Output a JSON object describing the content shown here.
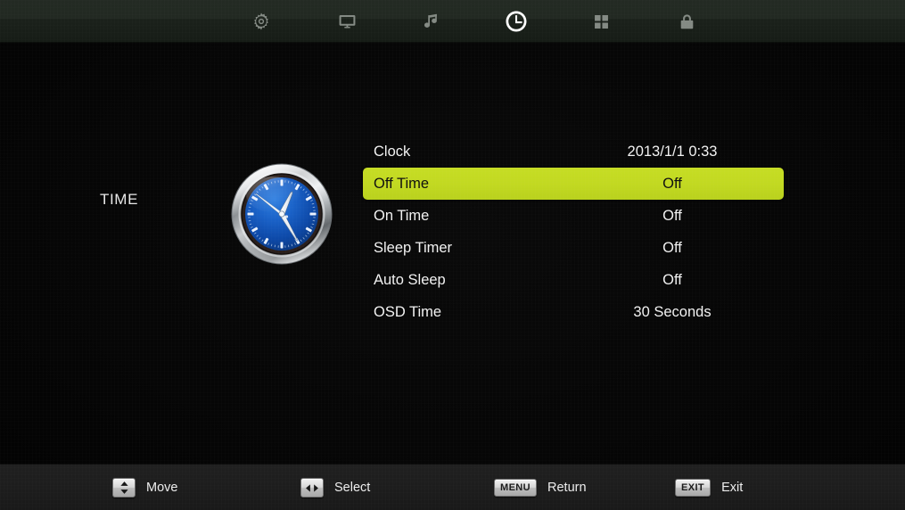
{
  "screen": {
    "title": "TIME",
    "accent_highlight": "#c2d921",
    "text_color": "#f2f2f2"
  },
  "topbar": {
    "icons": [
      {
        "name": "gear-icon",
        "label": "Picture Settings",
        "selected": false
      },
      {
        "name": "monitor-icon",
        "label": "Screen",
        "selected": false
      },
      {
        "name": "music-note-icon",
        "label": "Sound",
        "selected": false
      },
      {
        "name": "clock-icon",
        "label": "Time",
        "selected": true
      },
      {
        "name": "grid-icon",
        "label": "Option",
        "selected": false
      },
      {
        "name": "lock-icon",
        "label": "Lock",
        "selected": false
      }
    ]
  },
  "clock_graphic": {
    "name": "analog-clock-illustration",
    "face_color": "#0d49a8",
    "bezel_color": "#c9cbcd"
  },
  "menu": {
    "rows": [
      {
        "label": "Clock",
        "value": "2013/1/1 0:33",
        "selected": false
      },
      {
        "label": "Off Time",
        "value": "Off",
        "selected": true
      },
      {
        "label": "On Time",
        "value": "Off",
        "selected": false
      },
      {
        "label": "Sleep Timer",
        "value": "Off",
        "selected": false
      },
      {
        "label": "Auto Sleep",
        "value": "Off",
        "selected": false
      },
      {
        "label": "OSD Time",
        "value": "30 Seconds",
        "selected": false
      }
    ]
  },
  "bottombar": {
    "hints": [
      {
        "key": "",
        "key_icon": "up-down-arrows-icon",
        "label": "Move"
      },
      {
        "key": "",
        "key_icon": "left-right-arrows-icon",
        "label": "Select"
      },
      {
        "key": "MENU",
        "key_icon": "",
        "label": "Return"
      },
      {
        "key": "EXIT",
        "key_icon": "",
        "label": "Exit"
      }
    ]
  }
}
